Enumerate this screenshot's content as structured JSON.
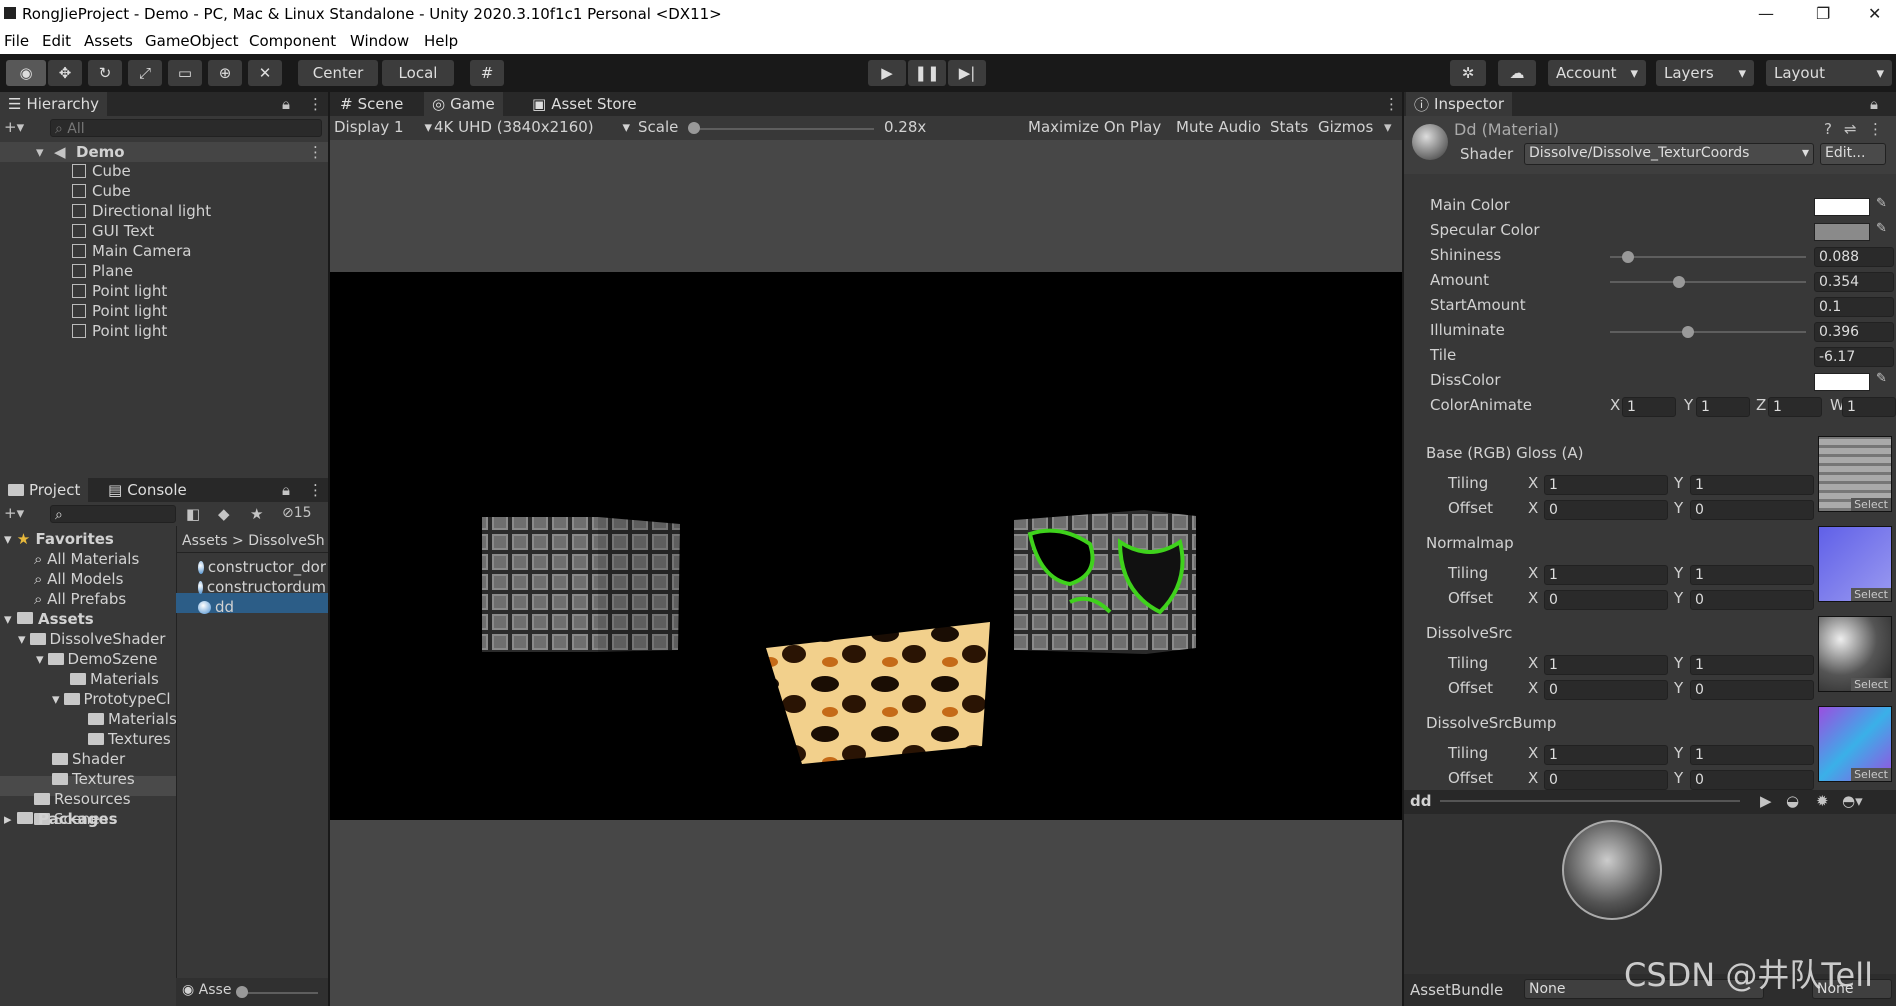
{
  "window": {
    "title": "RongJieProject - Demo - PC, Mac & Linux Standalone - Unity 2020.3.10f1c1 Personal <DX11>"
  },
  "menu": [
    "File",
    "Edit",
    "Assets",
    "GameObject",
    "Component",
    "Window",
    "Help"
  ],
  "toolbar": {
    "pivot": "Center",
    "space": "Local",
    "account": "Account",
    "layers": "Layers",
    "layout": "Layout"
  },
  "hierarchy": {
    "tab": "Hierarchy",
    "search_placeholder": "All",
    "scene": "Demo",
    "items": [
      "Cube",
      "Cube",
      "Directional light",
      "GUI Text",
      "Main Camera",
      "Plane",
      "Point light",
      "Point light",
      "Point light"
    ]
  },
  "project": {
    "tab_project": "Project",
    "tab_console": "Console",
    "hidden_count": "15",
    "favorites": "Favorites",
    "fav_items": [
      "All Materials",
      "All Models",
      "All Prefabs"
    ],
    "assets": "Assets",
    "tree": [
      "DissolveShader",
      "DemoSzene",
      "Materials",
      "PrototypeCl",
      "Materials",
      "Textures",
      "Shader",
      "Textures",
      "Resources",
      "Scenes"
    ],
    "packages": "Packages",
    "breadcrumb": [
      "Assets",
      ">",
      "DissolveSh"
    ],
    "files": [
      "constructor_dor",
      "constructordum",
      "dd"
    ],
    "footer": "Asse"
  },
  "game": {
    "tabs": [
      "Scene",
      "Game",
      "Asset Store"
    ],
    "display": "Display 1",
    "resolution": "4K UHD (3840x2160)",
    "scale_label": "Scale",
    "scale_value": "0.28x",
    "buttons": [
      "Maximize On Play",
      "Mute Audio",
      "Stats",
      "Gizmos"
    ]
  },
  "inspector": {
    "tab": "Inspector",
    "name": "Dd (Material)",
    "shader_label": "Shader",
    "shader": "Dissolve/Dissolve_TexturCoords",
    "edit": "Edit...",
    "props": [
      {
        "label": "Main Color"
      },
      {
        "label": "Specular Color"
      },
      {
        "label": "Shininess",
        "value": "0.088",
        "level": 0.09
      },
      {
        "label": "Amount",
        "value": "0.354",
        "level": 0.354
      },
      {
        "label": "StartAmount",
        "value": "0.1"
      },
      {
        "label": "Illuminate",
        "value": "0.396",
        "level": 0.396
      },
      {
        "label": "Tile",
        "value": "-6.17"
      },
      {
        "label": "DissColor"
      }
    ],
    "coloranimate": {
      "label": "ColorAnimate",
      "x": "1",
      "y": "1",
      "z": "1",
      "w": "1"
    },
    "textures": [
      {
        "label": "Base (RGB) Gloss (A)"
      },
      {
        "label": "Normalmap"
      },
      {
        "label": "DissolveSrc"
      },
      {
        "label": "DissolveSrcBump"
      }
    ],
    "tiling": "Tiling",
    "offset": "Offset",
    "tx": "1",
    "ty": "1",
    "ox": "0",
    "oy": "0",
    "select": "Select",
    "axis_x": "X",
    "axis_y": "Y",
    "axis_z": "Z",
    "axis_w": "W",
    "preview_name": "dd",
    "assetbundle_label": "AssetBundle",
    "assetbundle": "None",
    "assetbundle2": "None"
  },
  "watermark": "CSDN @井队Tell"
}
